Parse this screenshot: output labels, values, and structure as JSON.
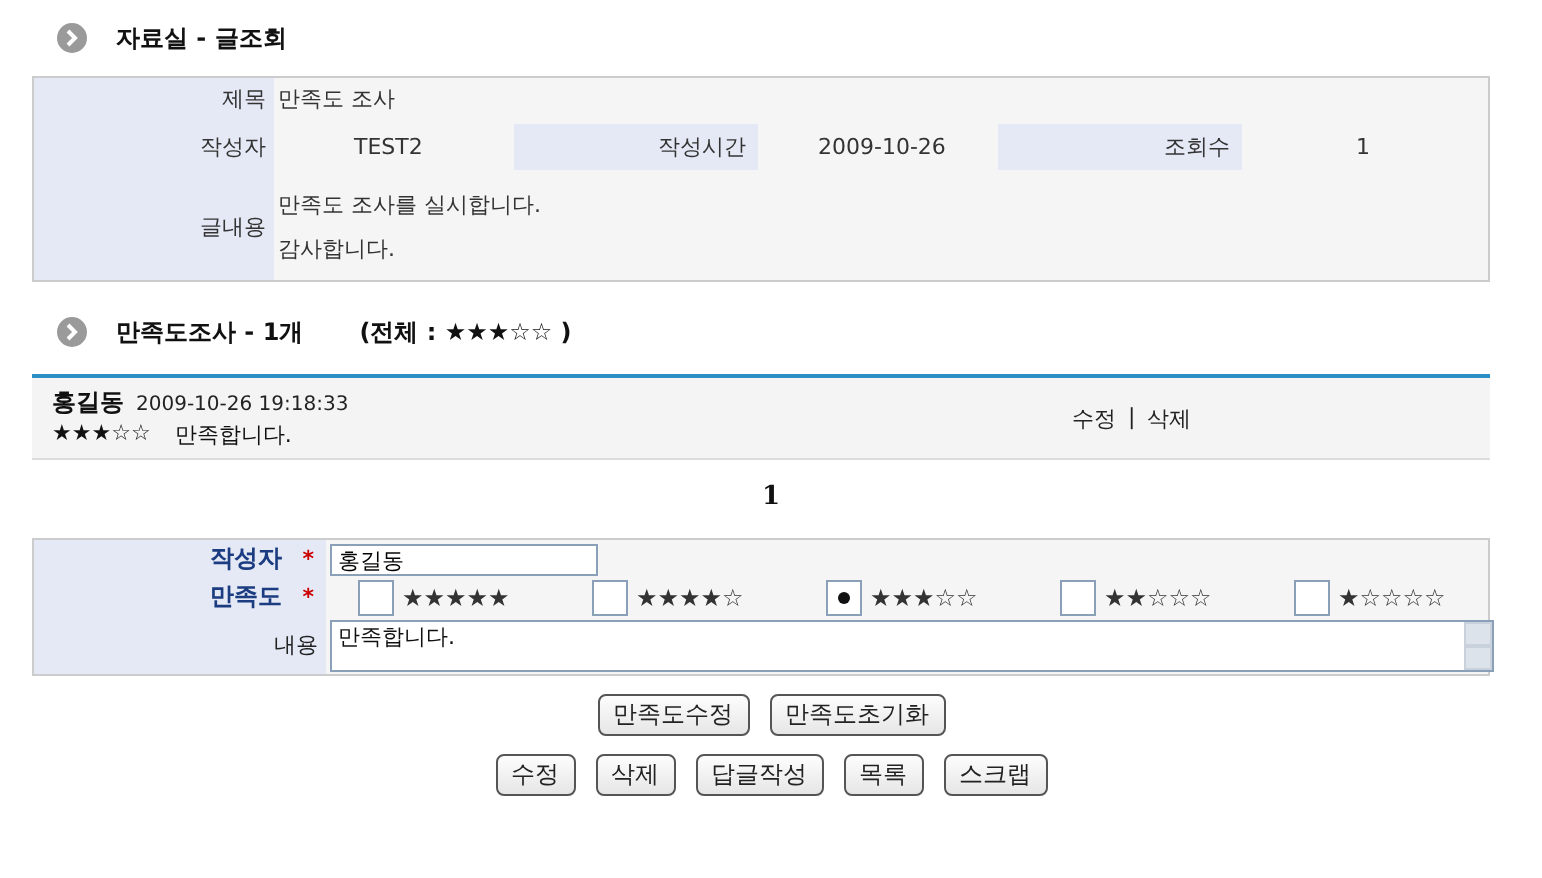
{
  "post_section": {
    "title": "자료실 - 글조회"
  },
  "post": {
    "subject_label": "제목",
    "subject": "만족도 조사",
    "author_label": "작성자",
    "author": "TEST2",
    "date_label": "작성시간",
    "date": "2009-10-26",
    "views_label": "조회수",
    "views": "1",
    "body_label": "글내용",
    "body_lines": [
      "만족도 조사를 실시합니다.",
      "감사합니다."
    ]
  },
  "survey_section": {
    "title": "만족도조사 - 1개",
    "overall": "(전체 : ★★★☆☆ )"
  },
  "comments": [
    {
      "author": "홍길동",
      "time": "2009-10-26 19:18:33",
      "stars": "★★★☆☆",
      "text": "만족합니다.",
      "edit": "수정",
      "separator": "|",
      "delete": "삭제"
    }
  ],
  "pagination": [
    {
      "label": "1",
      "selected": true
    }
  ],
  "form": {
    "author_label": "작성자",
    "author_value": "홍길동",
    "rating_label": "만족도",
    "required_mark": "*",
    "content_label": "내용",
    "content_value": "만족합니다.",
    "ratings": [
      {
        "label": "★★★★★",
        "selected": false
      },
      {
        "label": "★★★★☆",
        "selected": false
      },
      {
        "label": "★★★☆☆",
        "selected": true
      },
      {
        "label": "★★☆☆☆",
        "selected": false
      },
      {
        "label": "★☆☆☆☆",
        "selected": false
      }
    ]
  },
  "survey_buttons": [
    "만족도수정",
    "만족도초기화"
  ],
  "buttons": [
    "수정",
    "삭제",
    "답글작성",
    "목록",
    "스크랩"
  ]
}
